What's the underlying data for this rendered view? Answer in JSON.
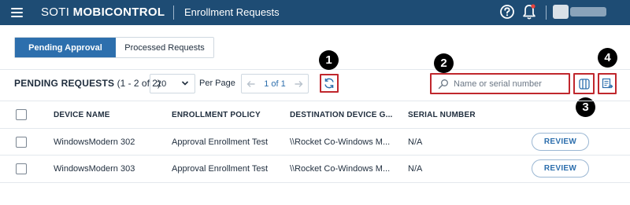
{
  "topbar": {
    "brand_part1": "SOTI ",
    "brand_part2": "MOBICONTROL",
    "page_title": "Enrollment Requests",
    "icons": [
      "menu-icon",
      "help-icon",
      "bell-icon",
      "user-avatar"
    ],
    "bar_color": "#1e4c74"
  },
  "tabs": [
    {
      "label": "Pending Approval",
      "active": true
    },
    {
      "label": "Processed Requests",
      "active": false
    }
  ],
  "toolbar": {
    "title": "PENDING REQUESTS",
    "count": " (1 - 2 of 2)",
    "page_size": "20",
    "per_page_label": "Per Page",
    "pager_text": "1 of 1",
    "search_placeholder": "Name or serial number",
    "search_value": "",
    "icons": [
      "refresh-icon",
      "search-icon",
      "columns-icon",
      "export-icon"
    ]
  },
  "callouts": [
    "1",
    "2",
    "3",
    "4"
  ],
  "table": {
    "columns": [
      "DEVICE NAME",
      "ENROLLMENT POLICY",
      "DESTINATION DEVICE G...",
      "SERIAL NUMBER"
    ],
    "rows": [
      {
        "device": "WindowsModern 302",
        "policy": "Approval Enrollment Test",
        "destination": "\\\\Rocket Co-Windows M...",
        "serial": "N/A",
        "action": "REVIEW"
      },
      {
        "device": "WindowsModern 303",
        "policy": "Approval Enrollment Test",
        "destination": "\\\\Rocket Co-Windows M...",
        "serial": "N/A",
        "action": "REVIEW"
      }
    ]
  },
  "colors": {
    "accent": "#2d6fad",
    "highlight": "#c0272d"
  }
}
